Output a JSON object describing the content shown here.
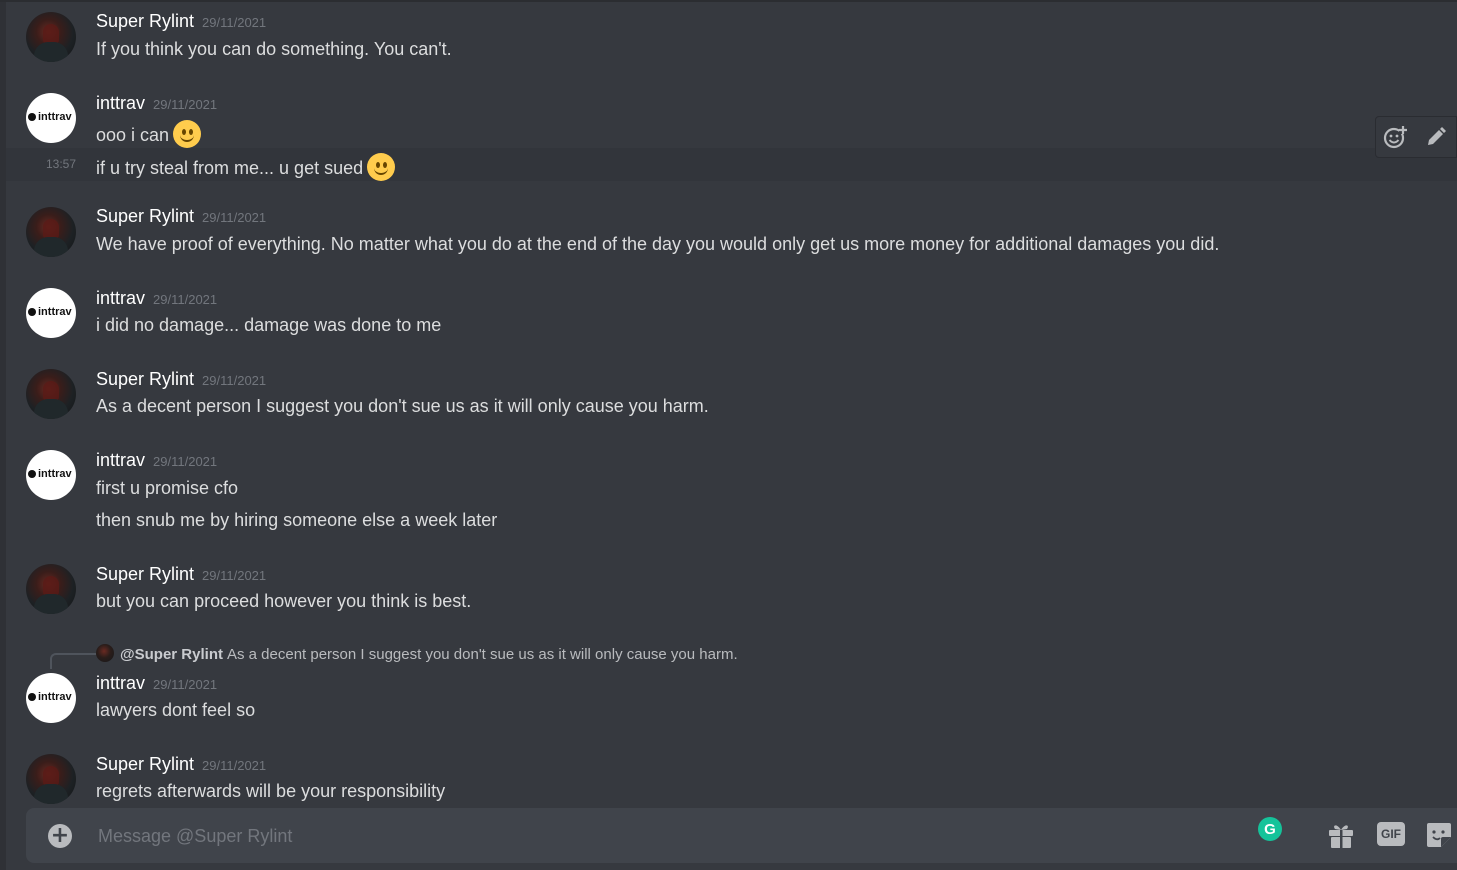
{
  "chat": {
    "messages": [
      {
        "author": "Super Rylint",
        "date": "29/11/2021",
        "lines": [
          "If you think you can do something. You can't."
        ]
      },
      {
        "author": "inttrav",
        "date": "29/11/2021",
        "lines": [
          "ooo i can",
          "if u try steal from me... u get sued"
        ],
        "side_time": "13:57"
      },
      {
        "author": "Super Rylint",
        "date": "29/11/2021",
        "lines": [
          "We have proof of everything. No matter what you do at the end of the day you would only get us more money for additional damages you did."
        ]
      },
      {
        "author": "inttrav",
        "date": "29/11/2021",
        "lines": [
          "i did no damage... damage was done to me"
        ]
      },
      {
        "author": "Super Rylint",
        "date": "29/11/2021",
        "lines": [
          "As a decent person I suggest you don't sue us as it will only cause you harm."
        ]
      },
      {
        "author": "inttrav",
        "date": "29/11/2021",
        "lines": [
          "first u promise cfo",
          "then snub me by hiring someone else a week later"
        ]
      },
      {
        "author": "Super Rylint",
        "date": "29/11/2021",
        "lines": [
          "but you can proceed however you think is best."
        ]
      },
      {
        "author": "inttrav",
        "date": "29/11/2021",
        "lines": [
          "lawyers dont feel so"
        ],
        "reply": {
          "user": "@Super Rylint",
          "text": "As a decent person I suggest you don't sue us as it will only cause you harm."
        }
      },
      {
        "author": "Super Rylint",
        "date": "29/11/2021",
        "lines": [
          "regrets afterwards will be your responsibility"
        ]
      }
    ]
  },
  "avatar_logo_text": "inttrav",
  "emoji": "slightly-smiling-face",
  "toolbar": {
    "add_reaction_icon": "add-reaction-icon",
    "edit_icon": "pencil-icon"
  },
  "composer": {
    "placeholder": "Message @Super Rylint",
    "value": "",
    "add_icon": "plus-circle-icon",
    "grammarly_label": "G",
    "gif_label": "GIF",
    "gift_icon": "gift-icon",
    "sticker_icon": "sticker-icon"
  },
  "colors": {
    "background": "#36393f",
    "composer_bg": "#40444b",
    "username": "#ffffff",
    "timestamp": "#72767d",
    "text": "#dcddde",
    "grammarly": "#15c39a"
  }
}
